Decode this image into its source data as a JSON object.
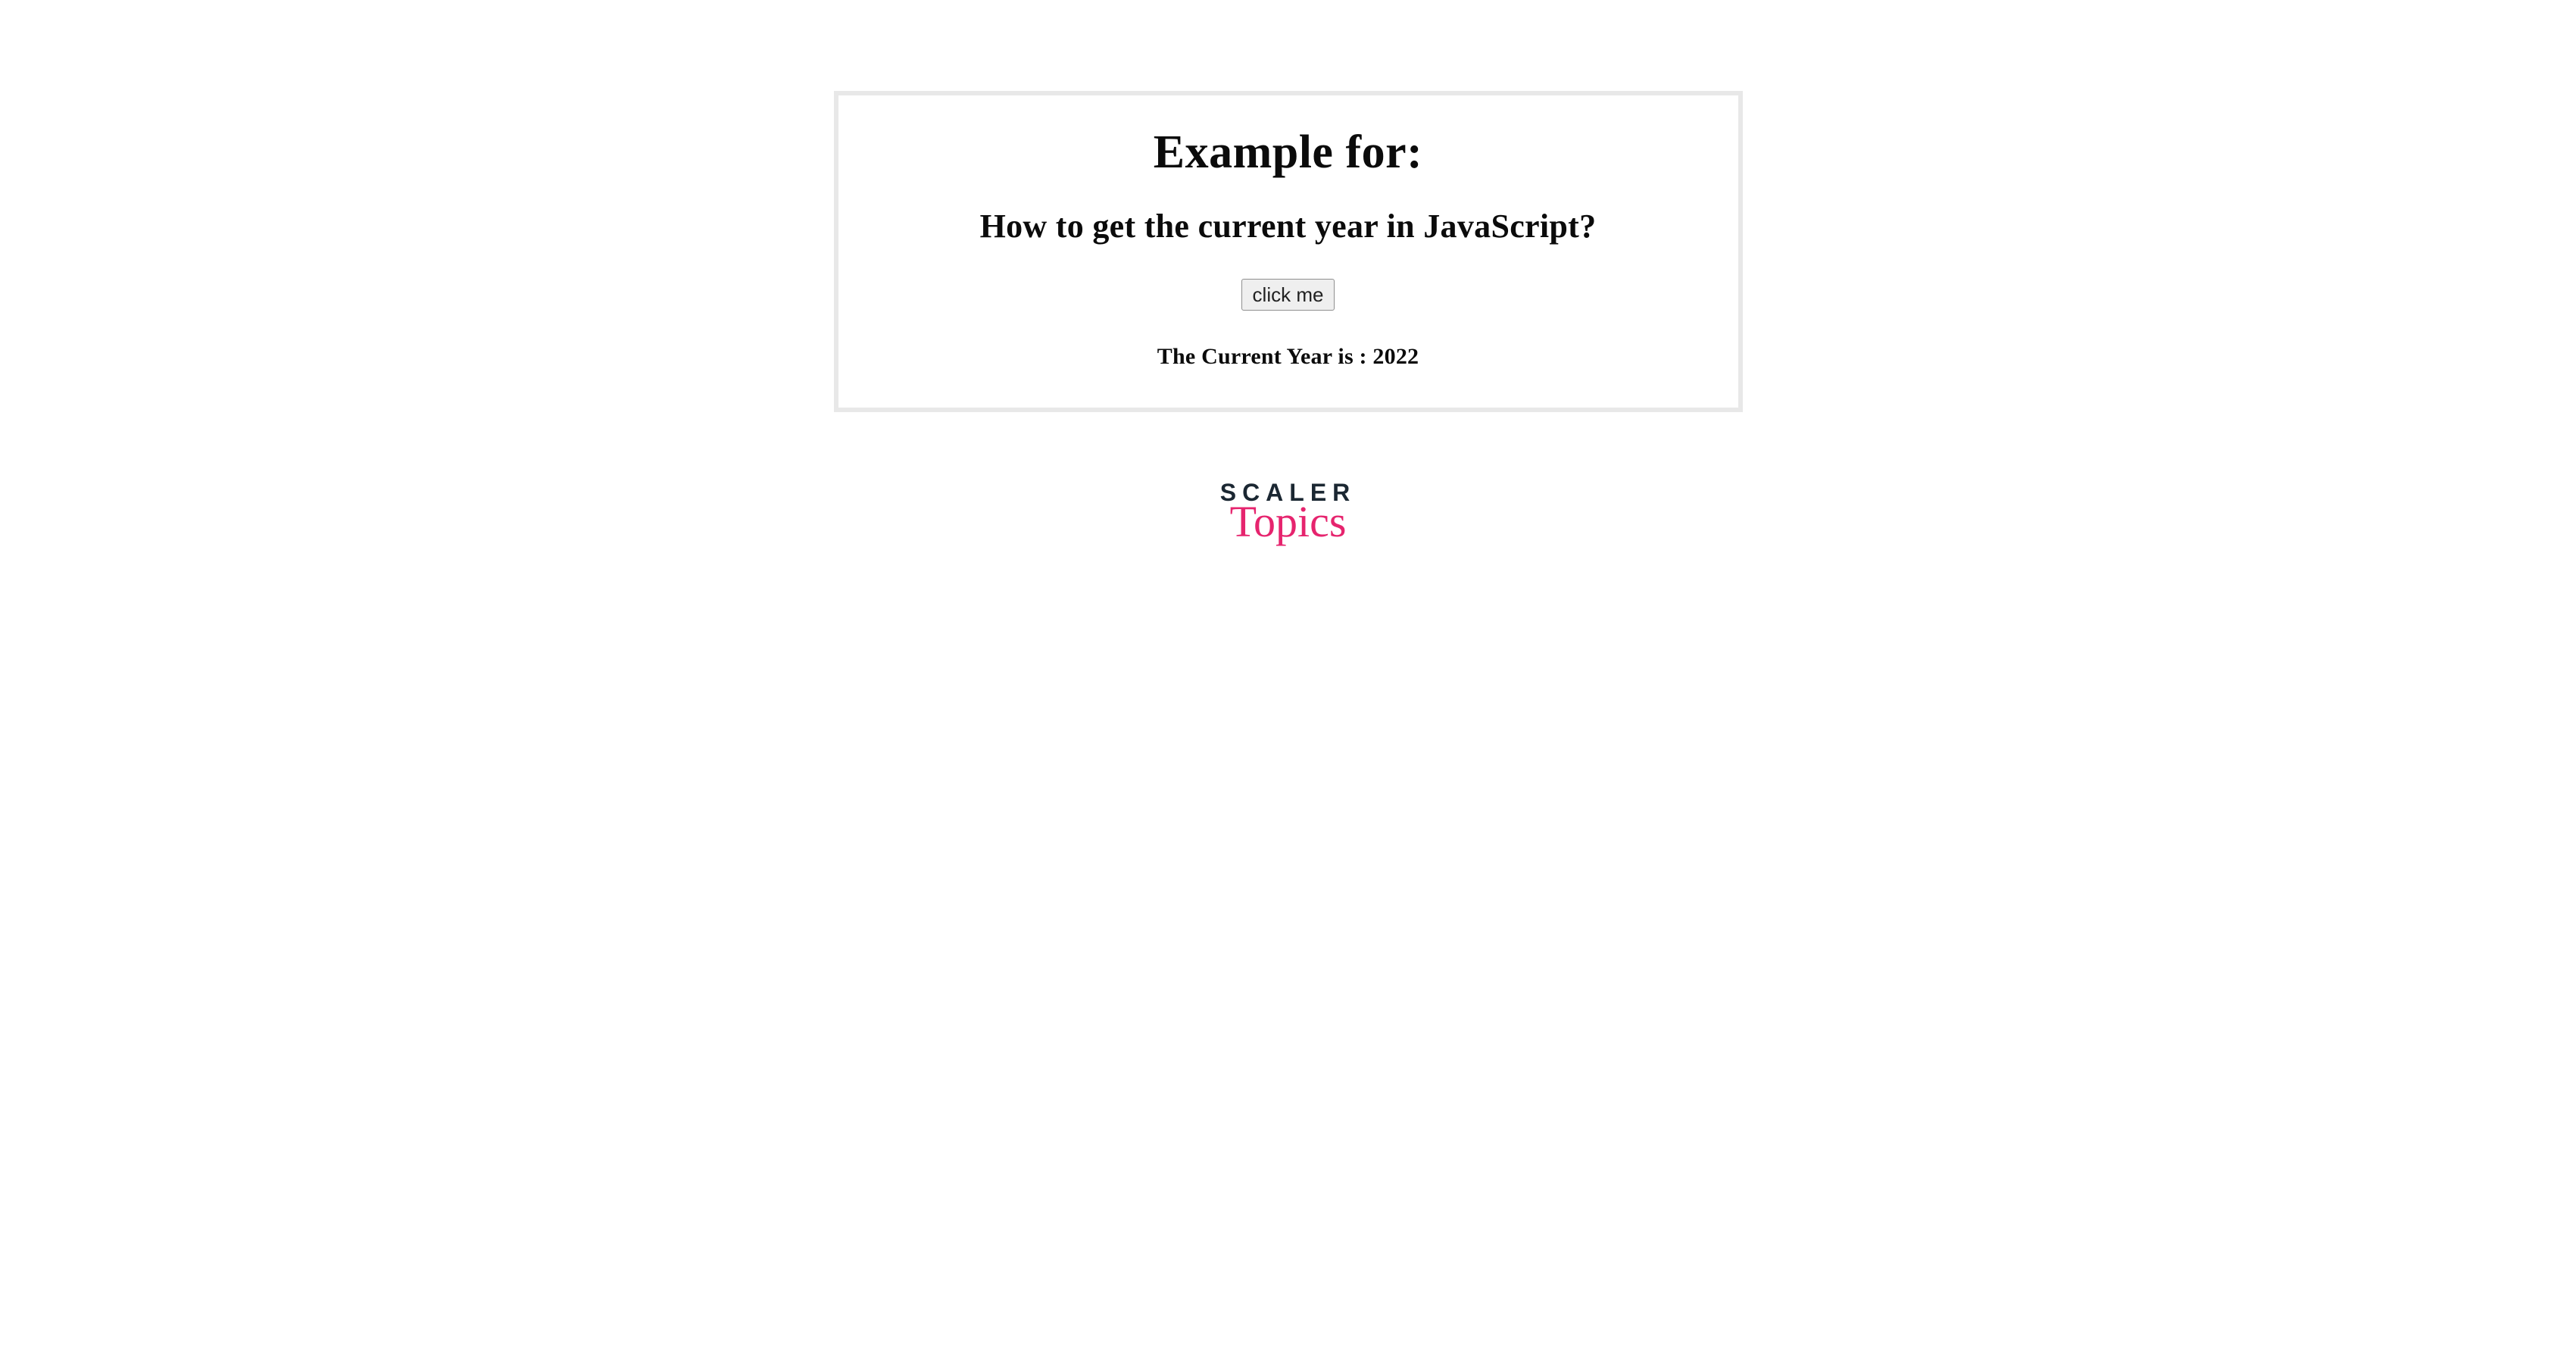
{
  "box": {
    "title": "Example for:",
    "subtitle": "How to get the current year in JavaScript?",
    "button_label": "click me",
    "result_text": "The Current Year is : 2022"
  },
  "logo": {
    "top": "SCALER",
    "bottom": "Topics"
  }
}
